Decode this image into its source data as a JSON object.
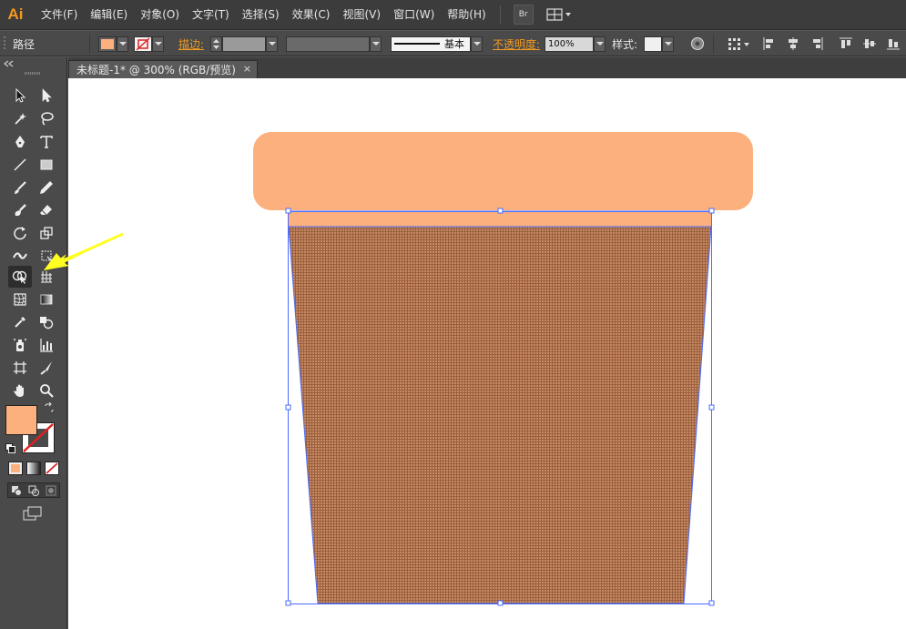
{
  "app": {
    "logo": "Ai"
  },
  "menu": {
    "items": [
      "文件(F)",
      "编辑(E)",
      "对象(O)",
      "文字(T)",
      "选择(S)",
      "效果(C)",
      "视图(V)",
      "窗口(W)",
      "帮助(H)"
    ],
    "bridge_label": "Br"
  },
  "control": {
    "object_type": "路径",
    "fill_color": "#fbb07e",
    "stroke_label": "描边:",
    "stroke_style_label": "基本",
    "opacity_label": "不透明度:",
    "opacity_value": "100%",
    "style_label": "样式:"
  },
  "tabs": [
    {
      "title": "未标题-1* @ 300% (RGB/预览)",
      "close": "×"
    }
  ],
  "colors": {
    "fill": "#fbb07e",
    "cup_body": "#b8784f",
    "selection": "#4a6cff",
    "arrow": "#ffff22"
  }
}
